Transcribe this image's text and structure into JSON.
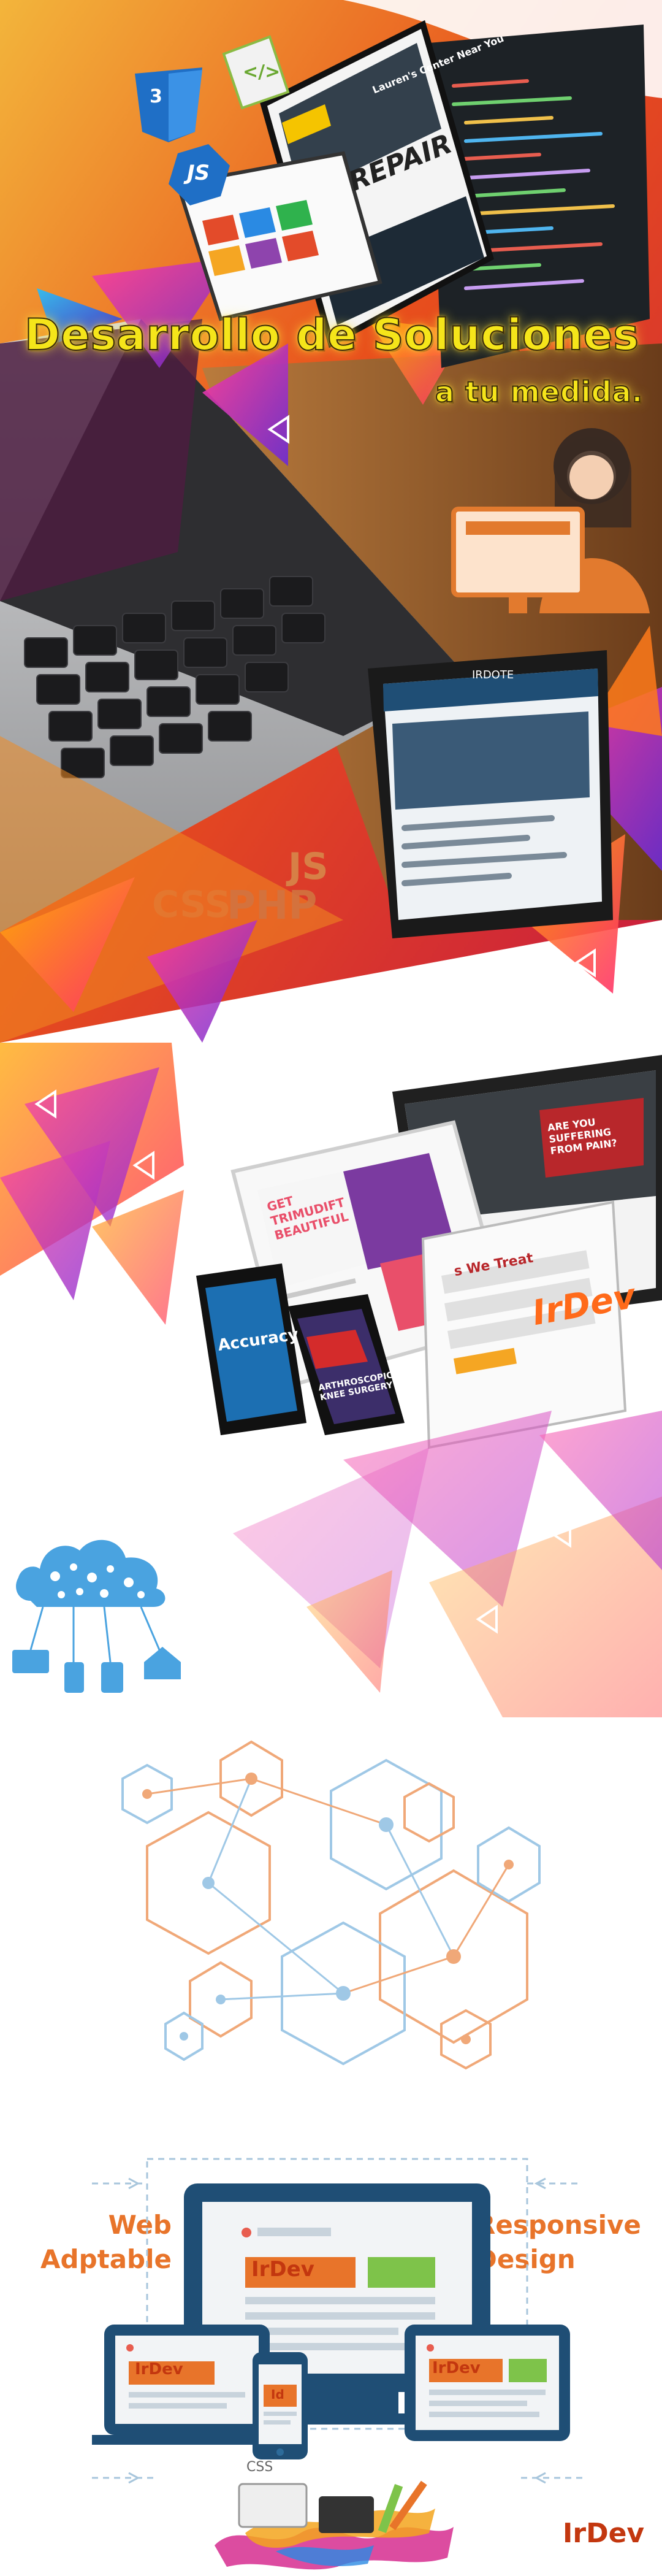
{
  "hero": {
    "title": "Desarrollo de Soluciones",
    "subtitle": "a tu medida.",
    "tech_js": "JS",
    "tech_css": "CSS",
    "tech_php": "PHP",
    "tablet_headline": "REPAIR",
    "laptop_banner": "Lauren's Center Near You",
    "phone_header": "IRDOTE"
  },
  "devices": {
    "brand_overlay": "IrDev",
    "tablet_headline": "GET TRIMUDIFT BEAUTIFUL",
    "laptop_headline": "ARE YOU SUFFERING FROM PAIN?",
    "section_label": "s We Treat",
    "phone_headline": "Accuracy",
    "phone2_headline": "ARTHROSCOPIC KNEE SURGERY"
  },
  "responsive": {
    "left_tagline": "Web Adptable",
    "right_tagline": "Responsive Design",
    "monitor_brand": "IrDev",
    "laptop_brand": "IrDev",
    "tablet_brand": "IrDev",
    "phone_brand": "Id",
    "css_label": "CSS"
  },
  "footer": {
    "brand": "IrDev"
  },
  "colors": {
    "accent_orange": "#e8742a",
    "brand_red": "#c3370f",
    "navy": "#1f4e75",
    "title_yellow": "#f5e51a",
    "magenta": "#d62d8f"
  }
}
